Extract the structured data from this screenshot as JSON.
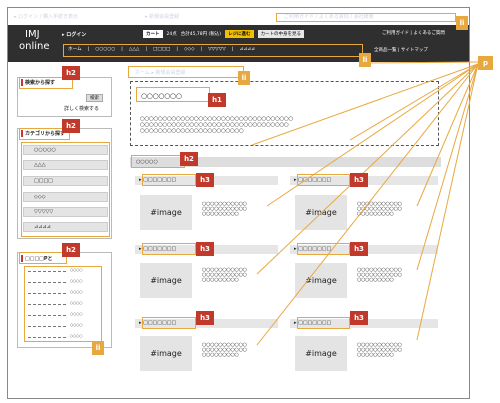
{
  "faint_top": {
    "left": "▸ ログイン / 購入手続き表示",
    "mid": "▸ 新規会員登録",
    "right": "ご利用ガイド / よくある質問 / 会社概要"
  },
  "header": {
    "logo_line1": "IMJ",
    "logo_line2": "online",
    "login": "▸ ログイン",
    "cart_label": "カート",
    "cart_count": "24点",
    "cart_total": "合計45,78円 (税込)",
    "checkout": "レジに進む",
    "cart_contents": "カートの中身を見る",
    "guide": "ご利用ガイド | よくあるご質問"
  },
  "nav": {
    "items": [
      "ホーム",
      "○○○○○",
      "△△△",
      "□□□□",
      "◇◇◇",
      "▽▽▽▽▽",
      "⊿⊿⊿⊿"
    ],
    "right": "全商品一覧 | サイトマップ"
  },
  "breadcrumb": "ホーム ▸ 新規会員登録",
  "sidebar": {
    "search_title": "検索から探す",
    "search_btn": "検索",
    "adv_search": "詳しく検索する",
    "cat_title": "カテゴリから探す",
    "categories": [
      "○○○○○",
      "△△△",
      "□□□□",
      "◇◇◇",
      "▽▽▽▽▽",
      "⊿⊿⊿⊿"
    ],
    "new_title": "□□□□Pと",
    "new_items": [
      "--------- ○○○",
      "--------- ○○○",
      "--------- ○○○",
      "--------- ○○○",
      "--------- ○○○",
      "--------- ○○○",
      "--------- ○○○"
    ],
    "new_label": "○○○○"
  },
  "main": {
    "h1": "○○○○○○○",
    "body_lines": [
      "○○○○○○○○○○○○○○○○○○○○○○○○○○○○○○○○○○",
      "○○○○○○○○○○○○○○○○○○○○○○○○○○○○○○○○○",
      "○○○○○○○○○○○○○○○○○○○○○○○"
    ],
    "section": "○○○○○",
    "card_title": "▸ □□□□□□□",
    "image": "#image",
    "card_lines": [
      "○○○○○○○○○○○",
      "○○○○○○○○○○○",
      "○○○○○○○○○"
    ]
  },
  "labels": {
    "h1": "h1",
    "h2": "h2",
    "h3": "h3",
    "li": "li",
    "p": "p"
  }
}
